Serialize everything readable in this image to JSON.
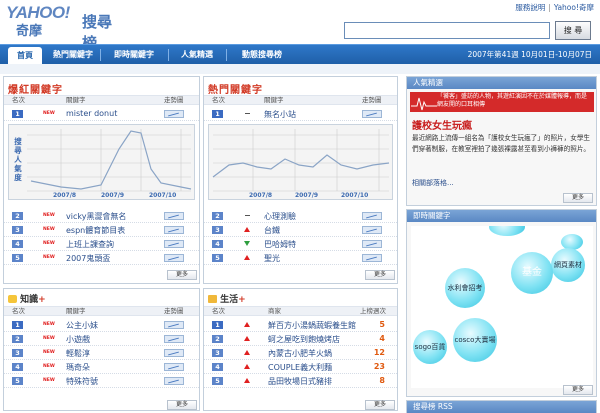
{
  "brand": {
    "logo": "YAHOO!",
    "sub": "奇摩",
    "section": "搜尋榜"
  },
  "top_links": [
    "服務說明",
    "Yahoo!奇摩"
  ],
  "search": {
    "value": "",
    "button": "搜 尋"
  },
  "nav": [
    "首頁",
    "熱門關鍵字",
    "即時關鍵字",
    "人氣精選",
    "動態搜尋榜"
  ],
  "week_info": "2007年第41週 10月01日-10月07日",
  "col_headers": {
    "rank": "名次",
    "keyword": "關鍵字",
    "trend": "走勢圖",
    "partner": "商家",
    "count": "上榜週次"
  },
  "hot_soar": {
    "title": "爆紅關鍵字",
    "top": {
      "rank": "1",
      "tag": "NEW",
      "keyword": "mister donut"
    },
    "chart_ylabel": "搜尋人氣度",
    "chart_dates": [
      "2007/8",
      "2007/9",
      "2007/10"
    ],
    "rows": [
      {
        "rank": "2",
        "tag": "NEW",
        "keyword": "vicky黑澀會無名"
      },
      {
        "rank": "3",
        "tag": "NEW",
        "keyword": "espn體育節目表"
      },
      {
        "rank": "4",
        "tag": "NEW",
        "keyword": "上班上課查詢"
      },
      {
        "rank": "5",
        "tag": "NEW",
        "keyword": "2007鬼頭盃"
      }
    ],
    "more": "更多"
  },
  "popular": {
    "title": "熱門關鍵字",
    "top": {
      "rank": "1",
      "keyword": "無名小站"
    },
    "chart_dates": [
      "2007/8",
      "2007/9",
      "2007/10"
    ],
    "rows": [
      {
        "rank": "2",
        "keyword": "心理測驗",
        "move": "same"
      },
      {
        "rank": "3",
        "keyword": "台鐵",
        "move": "up"
      },
      {
        "rank": "4",
        "keyword": "巴哈姆特",
        "move": "down"
      },
      {
        "rank": "5",
        "keyword": "聖光",
        "move": "up"
      }
    ],
    "more": "更多"
  },
  "knowledge": {
    "title": "知識",
    "plus": "+",
    "rows": [
      {
        "rank": "1",
        "tag": "NEW",
        "keyword": "公主小妹"
      },
      {
        "rank": "2",
        "tag": "NEW",
        "keyword": "小遊戲"
      },
      {
        "rank": "3",
        "tag": "NEW",
        "keyword": "輕鬆淳"
      },
      {
        "rank": "4",
        "tag": "NEW",
        "keyword": "瑪奇朵"
      },
      {
        "rank": "5",
        "tag": "NEW",
        "keyword": "特殊符號"
      }
    ],
    "more": "更多"
  },
  "life": {
    "title": "生活",
    "plus": "+",
    "rows": [
      {
        "rank": "1",
        "keyword": "鮮百方小湯鍋蔬蝦養生館",
        "count": "5"
      },
      {
        "rank": "2",
        "keyword": "蚵之屋吃到飽燒烤店",
        "count": "4"
      },
      {
        "rank": "3",
        "keyword": "內蒙古小肥羊火鍋",
        "count": "12"
      },
      {
        "rank": "4",
        "keyword": "COUPLE義大利麵",
        "count": "23"
      },
      {
        "rank": "5",
        "keyword": "品田牧場日式豬排",
        "count": "8"
      }
    ],
    "more": "更多"
  },
  "featured": {
    "header": "人氣精選",
    "banner": "「饕客」盛訪的人物，其遊紅演因不在於媒體報導，而是網友開的口耳相傳",
    "title": "護校女生玩瘋",
    "body": "最近網路上流傳一組名為「護校女生玩瘋了」的照片，女學生們穿著制服，在教室裡拍了幾張裸露甚至看到小褲褲的照片。",
    "related": "相關部落格...",
    "more": "更多"
  },
  "realtime": {
    "header": "即時關鍵字",
    "bubbles": [
      "網頁素材",
      "基金",
      "水利會招考",
      "cosco大賣場",
      "sogo百貨"
    ],
    "more": "更多"
  },
  "rss": {
    "header": "搜尋榜 RSS"
  }
}
